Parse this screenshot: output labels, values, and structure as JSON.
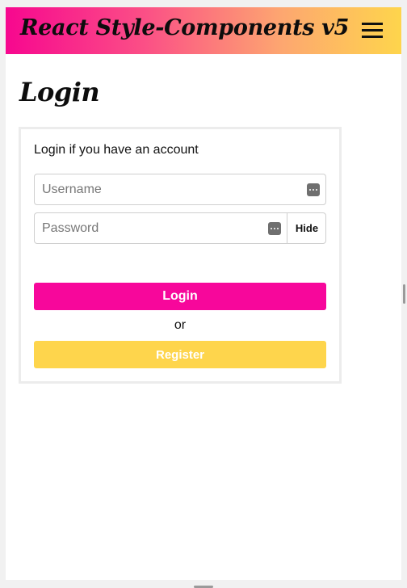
{
  "navbar": {
    "brand": "React Style-Components v5",
    "menu_icon": "hamburger-menu-icon"
  },
  "page": {
    "title": "Login"
  },
  "login_card": {
    "subtitle": "Login if you have an account",
    "username": {
      "placeholder": "Username",
      "value": "",
      "icon": "password-manager-key-icon"
    },
    "password": {
      "placeholder": "Password",
      "value": "",
      "icon": "password-manager-key-icon",
      "toggle_label": "Hide"
    },
    "login_button": "Login",
    "separator": "or",
    "register_button": "Register"
  },
  "colors": {
    "gradient_start": "#f7078f",
    "gradient_end": "#fed54c",
    "login_button": "#f7079b",
    "register_button": "#fed54c"
  }
}
